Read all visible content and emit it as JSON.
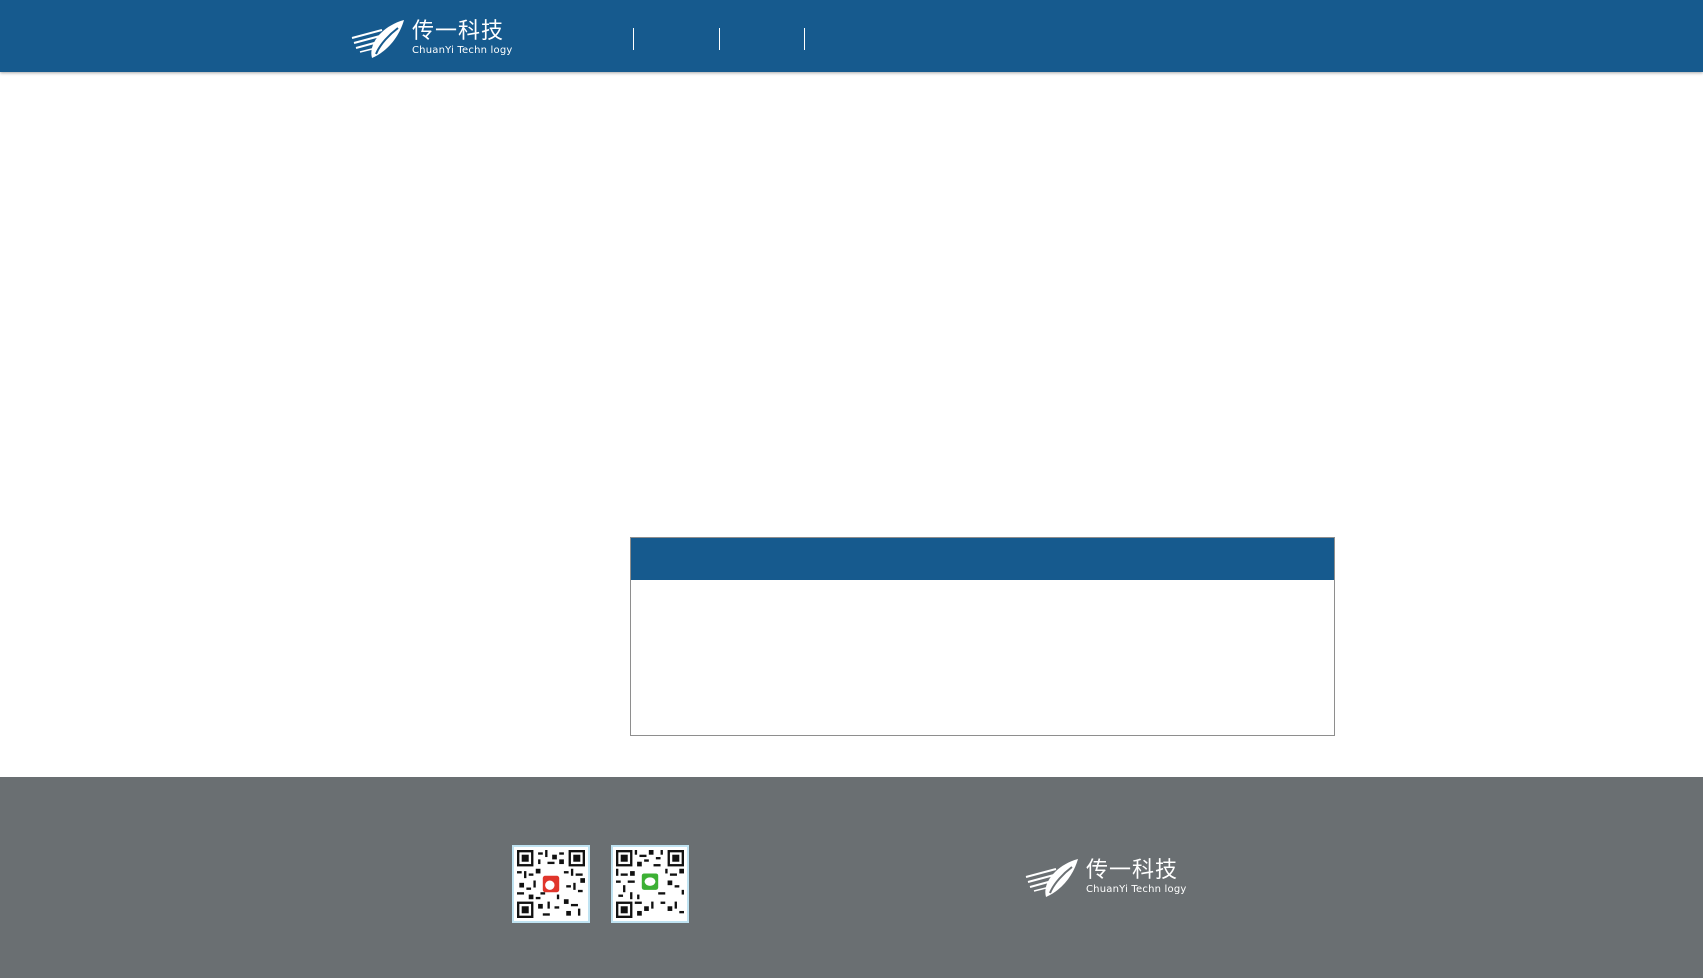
{
  "header": {
    "logo": {
      "name_cn": "传一科技",
      "name_en": "ChuanYi Techn logy"
    }
  },
  "footer": {
    "logo": {
      "name_cn": "传一科技",
      "name_en": "ChuanYi Techn logy"
    },
    "qr_codes": [
      {
        "icon": "weibo-icon",
        "badge_color": "#e0352b"
      },
      {
        "icon": "wechat-icon",
        "badge_color": "#3cb034"
      }
    ]
  },
  "colors": {
    "brand": "#165a8e",
    "footer_bg": "#6a6f72"
  }
}
